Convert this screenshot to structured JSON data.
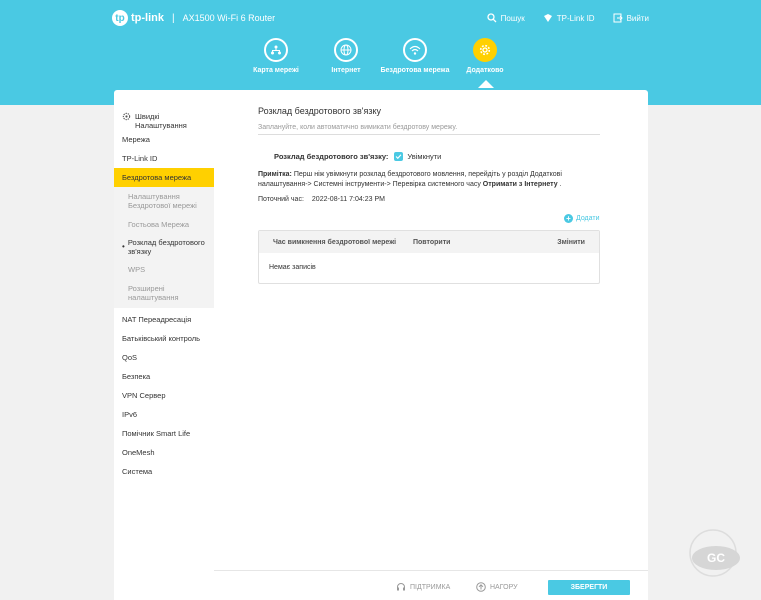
{
  "header": {
    "brand": "tp-link",
    "model": "AX1500 Wi-Fi 6 Router",
    "actions": {
      "search": "Пошук",
      "tplink_id": "TP-Link ID",
      "logout": "Вийти"
    }
  },
  "nav": {
    "items": [
      {
        "label": "Карта мережі",
        "icon": "network-map-icon"
      },
      {
        "label": "Інтернет",
        "icon": "globe-icon"
      },
      {
        "label": "Бездротова мережа",
        "icon": "wifi-icon"
      },
      {
        "label": "Додатково",
        "icon": "gear-icon",
        "active": true
      }
    ]
  },
  "sidebar": {
    "quick_setup": "Швидкі Налаштування",
    "items": {
      "network": "Мережа",
      "tplink_id": "TP-Link ID",
      "wireless": "Бездротова мережа",
      "nat": "NAT Переадресація",
      "parental": "Батьківський контроль",
      "qos": "QoS",
      "security": "Безпека",
      "vpn": "VPN Сервер",
      "ipv6": "IPv6",
      "smartlife": "Помічник Smart Life",
      "onemesh": "OneMesh",
      "system": "Система"
    },
    "wireless_sub": {
      "settings": "Налаштування Бездротової мережі",
      "guest": "Гостьова Мережа",
      "schedule": "Розклад бездротового зв'язку",
      "wps": "WPS",
      "advanced": "Розширені налаштування"
    }
  },
  "main": {
    "title": "Розклад бездротового зв'язку",
    "description": "Заплануйте, коли автоматично вимикати бездротову мережу.",
    "toggle_label": "Розклад бездротового зв'язку:",
    "toggle_value": "Увімкнути",
    "note_label": "Примітка:",
    "note_text": " Перш ніж увімкнути розклад бездротового мовлення, перейдіть у розділ Додаткові налаштування-> Системні інструменти-> Перевірка системного часу ",
    "note_bold_end": "Отримати з Інтернету",
    "note_tail": " .",
    "current_time_label": "Поточний час:",
    "current_time_value": "2022-08-11 7:04:23 PM",
    "add_label": "Додати",
    "table": {
      "columns": [
        "Час вимкнення бездротової мережі",
        "Повторити",
        "Змінити"
      ],
      "empty": "Немає записів"
    }
  },
  "footer": {
    "support": "ПІДТРИМКА",
    "top": "НАГОРУ",
    "save": "ЗБЕРЕГТИ"
  },
  "colors": {
    "accent": "#4ac9e3",
    "active": "#ffd000"
  }
}
